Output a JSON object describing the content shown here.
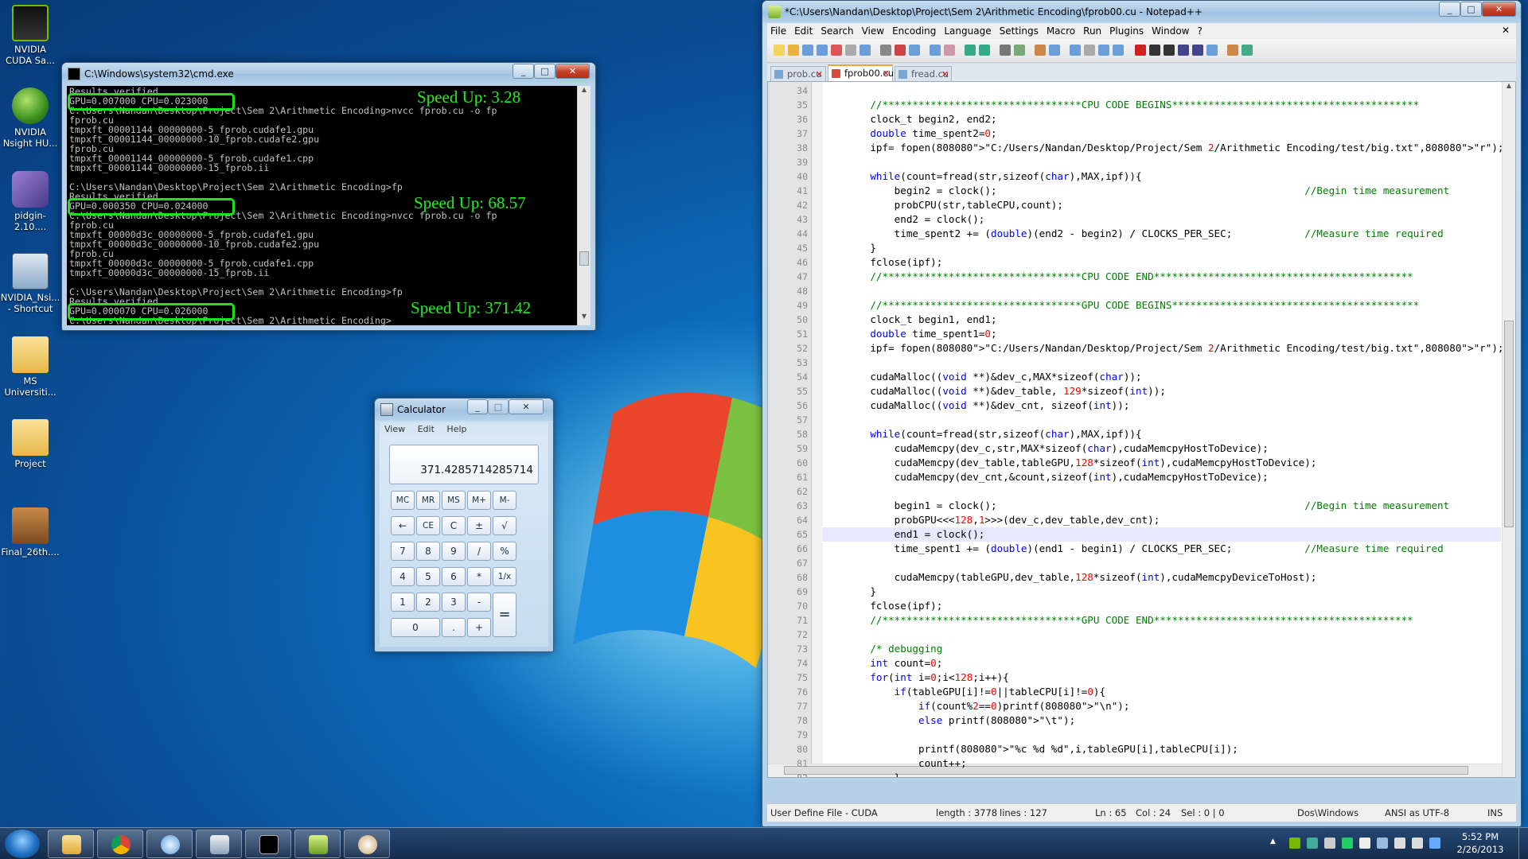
{
  "desktop": {
    "icons": [
      {
        "label": "NVIDIA CUDA Sa...",
        "icon": "nvidia-icon"
      },
      {
        "label": "NVIDIA Nsight HU...",
        "icon": "nsight-globe-icon"
      },
      {
        "label": "pidgin-2.10....",
        "icon": "pidgin-icon"
      },
      {
        "label": "NVIDIA_Nsi... - Shortcut",
        "icon": "shortcut-icon"
      },
      {
        "label": "MS Universiti...",
        "icon": "folder-icon"
      },
      {
        "label": "Project",
        "icon": "folder-icon"
      },
      {
        "label": "Final_26th....",
        "icon": "powerpoint-icon"
      }
    ]
  },
  "cmd": {
    "title": "C:\\Windows\\system32\\cmd.exe",
    "lines": [
      "Results verified...",
      "GPU=0.007000 CPU=0.023000",
      "C:\\Users\\Nandan\\Desktop\\Project\\Sem 2\\Arithmetic Encoding>nvcc fprob.cu -o fp",
      "fprob.cu",
      "tmpxft_00001144_00000000-5_fprob.cudafe1.gpu",
      "tmpxft_00001144_00000000-10_fprob.cudafe2.gpu",
      "fprob.cu",
      "tmpxft_00001144_00000000-5_fprob.cudafe1.cpp",
      "tmpxft_00001144_00000000-15_fprob.ii",
      "",
      "C:\\Users\\Nandan\\Desktop\\Project\\Sem 2\\Arithmetic Encoding>fp",
      "Results verified...",
      "GPU=0.000350 CPU=0.024000",
      "C:\\Users\\Nandan\\Desktop\\Project\\Sem 2\\Arithmetic Encoding>nvcc fprob.cu -o fp",
      "fprob.cu",
      "tmpxft_00000d3c_00000000-5_fprob.cudafe1.gpu",
      "tmpxft_00000d3c_00000000-10_fprob.cudafe2.gpu",
      "fprob.cu",
      "tmpxft_00000d3c_00000000-5_fprob.cudafe1.cpp",
      "tmpxft_00000d3c_00000000-15_fprob.ii",
      "",
      "C:\\Users\\Nandan\\Desktop\\Project\\Sem 2\\Arithmetic Encoding>fp",
      "Results verified...",
      "GPU=0.000070 CPU=0.026000",
      "C:\\Users\\Nandan\\Desktop\\Project\\Sem 2\\Arithmetic Encoding>"
    ],
    "speedups": [
      "Speed Up: 3.28",
      "Speed Up: 68.57",
      "Speed Up: 371.42"
    ],
    "highlight_color": "#1fe01f"
  },
  "calculator": {
    "title": "Calculator",
    "menu": [
      "View",
      "Edit",
      "Help"
    ],
    "display": "371.4285714285714",
    "buttons": [
      "MC",
      "MR",
      "MS",
      "M+",
      "M-",
      "←",
      "CE",
      "C",
      "±",
      "√",
      "7",
      "8",
      "9",
      "/",
      "%",
      "4",
      "5",
      "6",
      "*",
      "1/x",
      "1",
      "2",
      "3",
      "-",
      "=",
      "0",
      ".",
      "+"
    ]
  },
  "npp": {
    "title": "*C:\\Users\\Nandan\\Desktop\\Project\\Sem 2\\Arithmetic Encoding\\fprob00.cu - Notepad++",
    "menu": [
      "File",
      "Edit",
      "Search",
      "View",
      "Encoding",
      "Language",
      "Settings",
      "Macro",
      "Run",
      "Plugins",
      "Window",
      "?"
    ],
    "tabs": [
      "prob.cu",
      "fprob00.cu",
      "fread.cu"
    ],
    "active_tab": "fprob00.cu",
    "first_line": 34,
    "current_line": 65,
    "code": [
      "",
      "    //*********************************CPU CODE BEGINS*****************************************",
      "    clock_t begin2, end2;",
      "    double time_spent2=0;",
      "    ipf= fopen(\"C:/Users/Nandan/Desktop/Project/Sem 2/Arithmetic Encoding/test/big.txt\",\"r\");",
      "",
      "    while(count=fread(str,sizeof(char),MAX,ipf)){",
      "        begin2 = clock();                                                   //Begin time measurement",
      "        probCPU(str,tableCPU,count);",
      "        end2 = clock();",
      "        time_spent2 += (double)(end2 - begin2) / CLOCKS_PER_SEC;            //Measure time required",
      "    }",
      "    fclose(ipf);",
      "    //*********************************CPU CODE END*******************************************",
      "",
      "    //*********************************GPU CODE BEGINS*****************************************",
      "    clock_t begin1, end1;",
      "    double time_spent1=0;",
      "    ipf= fopen(\"C:/Users/Nandan/Desktop/Project/Sem 2/Arithmetic Encoding/test/big.txt\",\"r\");",
      "",
      "    cudaMalloc((void **)&dev_c,MAX*sizeof(char));",
      "    cudaMalloc((void **)&dev_table, 129*sizeof(int));",
      "    cudaMalloc((void **)&dev_cnt, sizeof(int));",
      "",
      "    while(count=fread(str,sizeof(char),MAX,ipf)){",
      "        cudaMemcpy(dev_c,str,MAX*sizeof(char),cudaMemcpyHostToDevice);",
      "        cudaMemcpy(dev_table,tableGPU,128*sizeof(int),cudaMemcpyHostToDevice);",
      "        cudaMemcpy(dev_cnt,&count,sizeof(int),cudaMemcpyHostToDevice);",
      "",
      "        begin1 = clock();                                                   //Begin time measurement",
      "        probGPU<<<128,1>>>(dev_c,dev_table,dev_cnt);",
      "        end1 = clock();",
      "        time_spent1 += (double)(end1 - begin1) / CLOCKS_PER_SEC;            //Measure time required",
      "",
      "        cudaMemcpy(tableGPU,dev_table,128*sizeof(int),cudaMemcpyDeviceToHost);",
      "    }",
      "    fclose(ipf);",
      "    //*********************************GPU CODE END*******************************************",
      "",
      "    /* debugging",
      "    int count=0;",
      "    for(int i=0;i<128;i++){",
      "        if(tableGPU[i]!=0||tableCPU[i]!=0){",
      "            if(count%2==0)printf(\"\\n\");",
      "            else printf(\"\\t\");",
      "",
      "            printf(\"%c %d %d\",i,tableGPU[i],tableCPU[i]);",
      "            count++;",
      "        }"
    ],
    "status": {
      "filetype": "User Define File - CUDA",
      "length": "length : 3778",
      "lines": "lines : 127",
      "ln": "Ln : 65",
      "col": "Col : 24",
      "sel": "Sel : 0 | 0",
      "eol": "Dos\\Windows",
      "encoding": "ANSI as UTF-8",
      "mode": "INS"
    }
  },
  "taskbar": {
    "time": "5:52 PM",
    "date": "2/26/2013"
  }
}
